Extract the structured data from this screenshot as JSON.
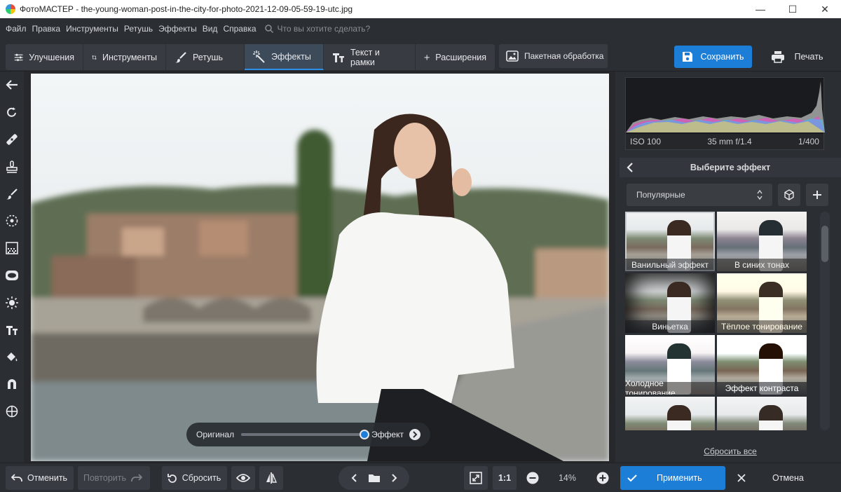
{
  "window": {
    "title": "ФотоМАСТЕР - the-young-woman-post-in-the-city-for-photo-2021-12-09-05-59-19-utc.jpg"
  },
  "menu": {
    "items": [
      "Файл",
      "Правка",
      "Инструменты",
      "Ретушь",
      "Эффекты",
      "Вид",
      "Справка"
    ],
    "search_placeholder": "Что вы хотите сделать?"
  },
  "toolbar": {
    "tabs": [
      {
        "label": "Улучшения",
        "icon": "sliders-icon"
      },
      {
        "label": "Инструменты",
        "icon": "crop-icon"
      },
      {
        "label": "Ретушь",
        "icon": "brush-icon"
      },
      {
        "label": "Эффекты",
        "icon": "magic-wand-icon",
        "active": true
      },
      {
        "label": "Текст и рамки",
        "icon": "text-icon"
      },
      {
        "label": "Расширения",
        "icon": "plus-icon"
      }
    ],
    "batch_label": "Пакетная обработка",
    "save_label": "Сохранить",
    "print_label": "Печать"
  },
  "histogram": {
    "iso": "ISO 100",
    "lens": "35 mm f/1.4",
    "shutter": "1/400"
  },
  "effects": {
    "heading": "Выберите эффект",
    "category": "Популярные",
    "items": [
      {
        "label": "Ванильный эффект"
      },
      {
        "label": "В синих тонах"
      },
      {
        "label": "Виньетка"
      },
      {
        "label": "Тёплое тонирование"
      },
      {
        "label": "Холодное тонирование"
      },
      {
        "label": "Эффект контраста"
      },
      {
        "label": ""
      },
      {
        "label": ""
      }
    ],
    "reset_all": "Сбросить все"
  },
  "compare": {
    "original": "Оригинал",
    "effect": "Эффект",
    "level": 1.0
  },
  "bottom": {
    "undo": "Отменить",
    "redo": "Повторить",
    "reset": "Сбросить",
    "ratio": "1:1",
    "zoom": "14%",
    "apply": "Применить",
    "cancel": "Отмена"
  },
  "colors": {
    "accent": "#1d7ed8",
    "panel": "#2b2e33",
    "button": "#383c42"
  }
}
